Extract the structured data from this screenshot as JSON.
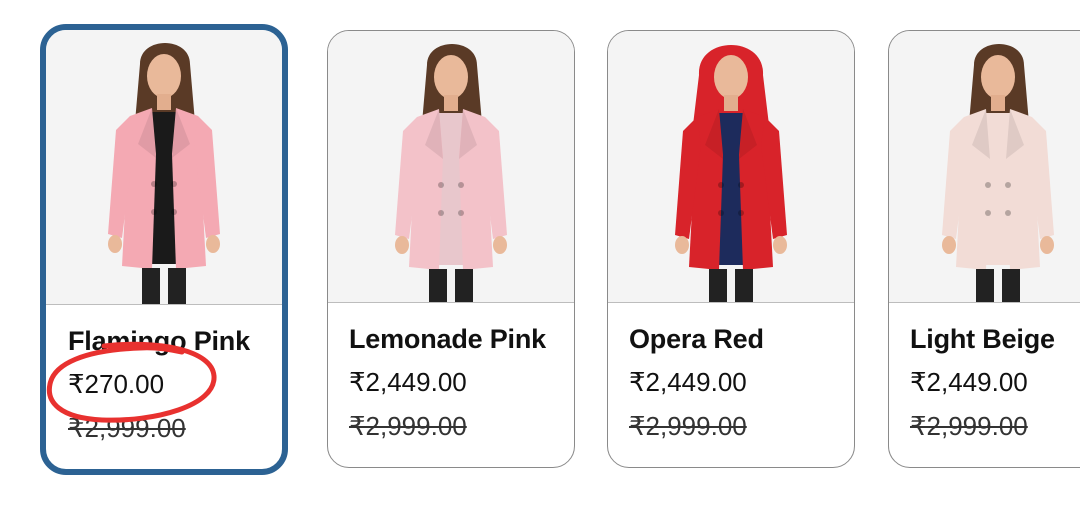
{
  "products": [
    {
      "name": "Flamingo Pink",
      "price": "₹270.00",
      "mrp": "₹2,999.00",
      "coat_color": "#f4a9b3",
      "inner_color": "#1a1a1a",
      "selected": true
    },
    {
      "name": "Lemonade Pink",
      "price": "₹2,449.00",
      "mrp": "₹2,999.00",
      "coat_color": "#f3c2c9",
      "inner_color": "#e8c7cc",
      "selected": false
    },
    {
      "name": "Opera Red",
      "price": "₹2,449.00",
      "mrp": "₹2,999.00",
      "coat_color": "#d8232a",
      "inner_color": "#1d2b5c",
      "selected": false
    },
    {
      "name": "Light Beige",
      "price": "₹2,449.00",
      "mrp": "₹2,999.00",
      "coat_color": "#f2dcd6",
      "inner_color": "#f2dcd6",
      "selected": false
    }
  ],
  "annotation": {
    "color": "#e8312f"
  }
}
